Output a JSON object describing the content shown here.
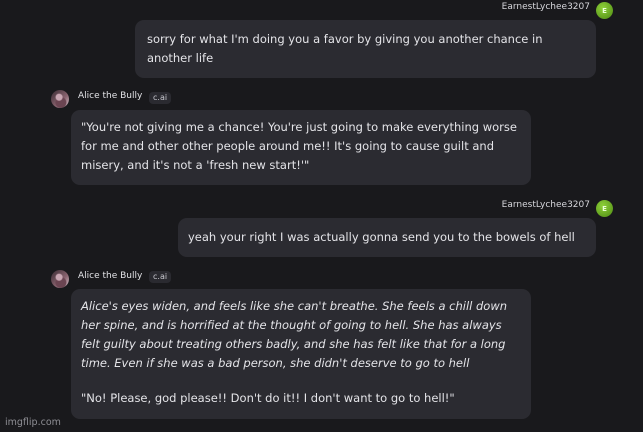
{
  "messages": [
    {
      "sender": "EarnestLychee3207",
      "avatar_initial": "E",
      "text": "sorry for what I'm doing you a favor by giving you another chance in another life"
    },
    {
      "sender": "Alice the Bully",
      "badge": "c.ai",
      "text": "\"You're not giving me a chance! You're just going to make everything worse for me and other other people around me!! It's going to cause guilt and misery, and it's not a 'fresh new start!'\""
    },
    {
      "sender": "EarnestLychee3207",
      "avatar_initial": "E",
      "text": "yeah your right I was actually gonna send you to the bowels of hell"
    },
    {
      "sender": "Alice the Bully",
      "badge": "c.ai",
      "action_text": "Alice's eyes widen, and feels like she can't breathe. She feels a chill down her spine, and is horrified at the thought of going to hell. She has always felt guilty about treating others badly, and she has felt like that for a long time. Even if she was a bad person, she didn't  deserve to go to hell",
      "speech_text": "\"No! Please, god please!! Don't do it!! I don't want to go to hell!\""
    }
  ],
  "watermark": "imgflip.com"
}
